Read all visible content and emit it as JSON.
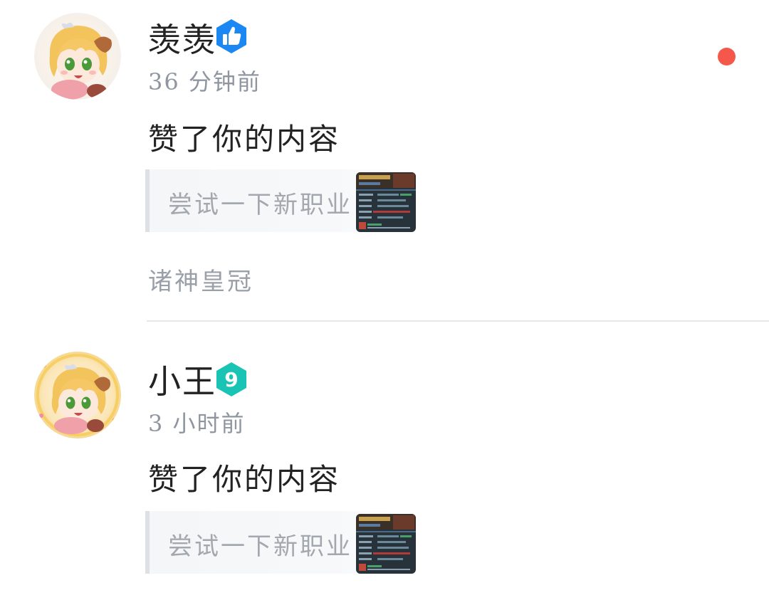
{
  "notifications": [
    {
      "username": "羡羡",
      "badge_icon": "thumbs-up-icon",
      "badge_color": "#1a87f2",
      "time": "36 分钟前",
      "action": "赞了你的内容",
      "quoted_text": "尝试一下新职业",
      "tag": "诸神皇冠",
      "unread": true
    },
    {
      "username": "小王",
      "badge_icon": "level-9-icon",
      "badge_level": "9",
      "badge_color": "#19c4b4",
      "time": "3 小时前",
      "action": "赞了你的内容",
      "quoted_text": "尝试一下新职业"
    }
  ],
  "colors": {
    "unread_dot": "#f5584a",
    "divider": "#e6e8eb",
    "muted_text": "#8f96a0"
  }
}
